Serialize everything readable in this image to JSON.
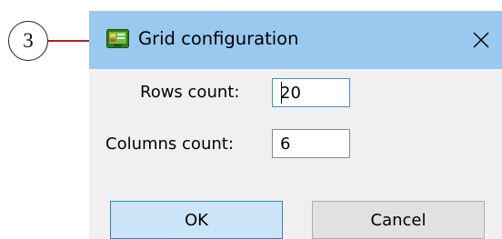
{
  "callout": {
    "number": "3"
  },
  "dialog": {
    "title": "Grid configuration",
    "close_symbol": "×",
    "icon": "grid-app-icon"
  },
  "fields": {
    "rows": {
      "label": "Rows count:",
      "value": "20"
    },
    "columns": {
      "label": "Columns count:",
      "value": "6"
    }
  },
  "buttons": {
    "ok": "OK",
    "cancel": "Cancel"
  },
  "colors": {
    "titlebar": "#99c9ef",
    "dialog_bg": "#f0f0f0",
    "callout_line": "#b0202a",
    "ok_bg": "#cce4f7",
    "ok_border": "#2f7fcf"
  }
}
